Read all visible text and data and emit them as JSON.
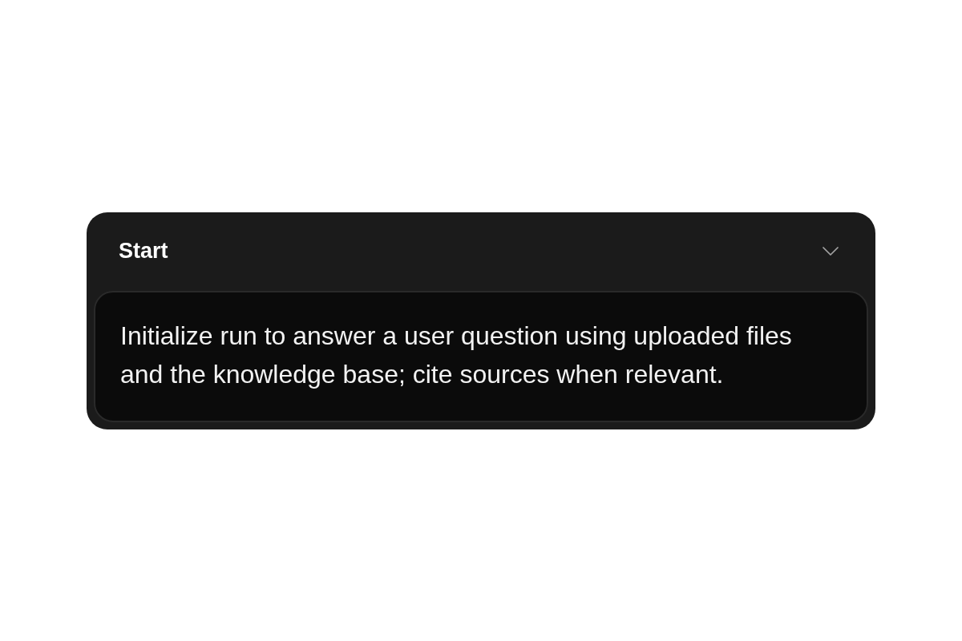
{
  "step": {
    "title": "Start",
    "expanded": true,
    "description": "Initialize run to answer a user question using uploaded files and the knowledge base; cite sources when relevant."
  }
}
